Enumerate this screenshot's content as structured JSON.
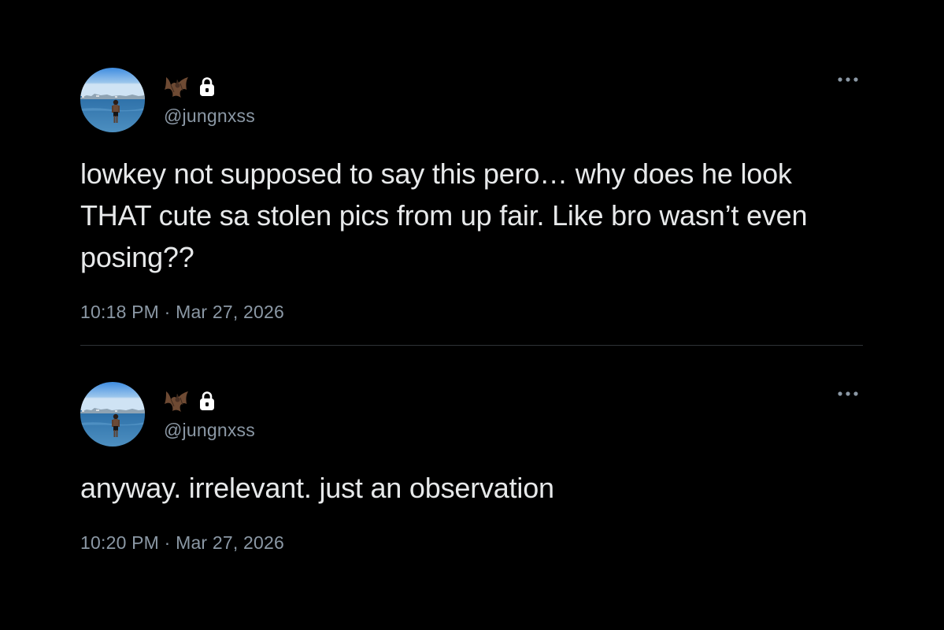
{
  "colors": {
    "background": "#000000",
    "text_primary": "#e7e9ea",
    "text_secondary": "#8b98a5",
    "divider": "#2f3336"
  },
  "tweets": [
    {
      "display_name_icons": [
        "bat-icon",
        "lock-icon"
      ],
      "handle": "@jungnxss",
      "text": "lowkey not supposed to say this pero… why does he look THAT cute sa stolen pics from up fair. Like bro wasn’t even posing??",
      "timestamp": "10:18 PM · Mar 27, 2026",
      "more_icon": "ellipsis-icon"
    },
    {
      "display_name_icons": [
        "bat-icon",
        "lock-icon"
      ],
      "handle": "@jungnxss",
      "text": "anyway. irrelevant. just an observation",
      "timestamp": "10:20 PM · Mar 27, 2026",
      "more_icon": "ellipsis-icon"
    }
  ]
}
